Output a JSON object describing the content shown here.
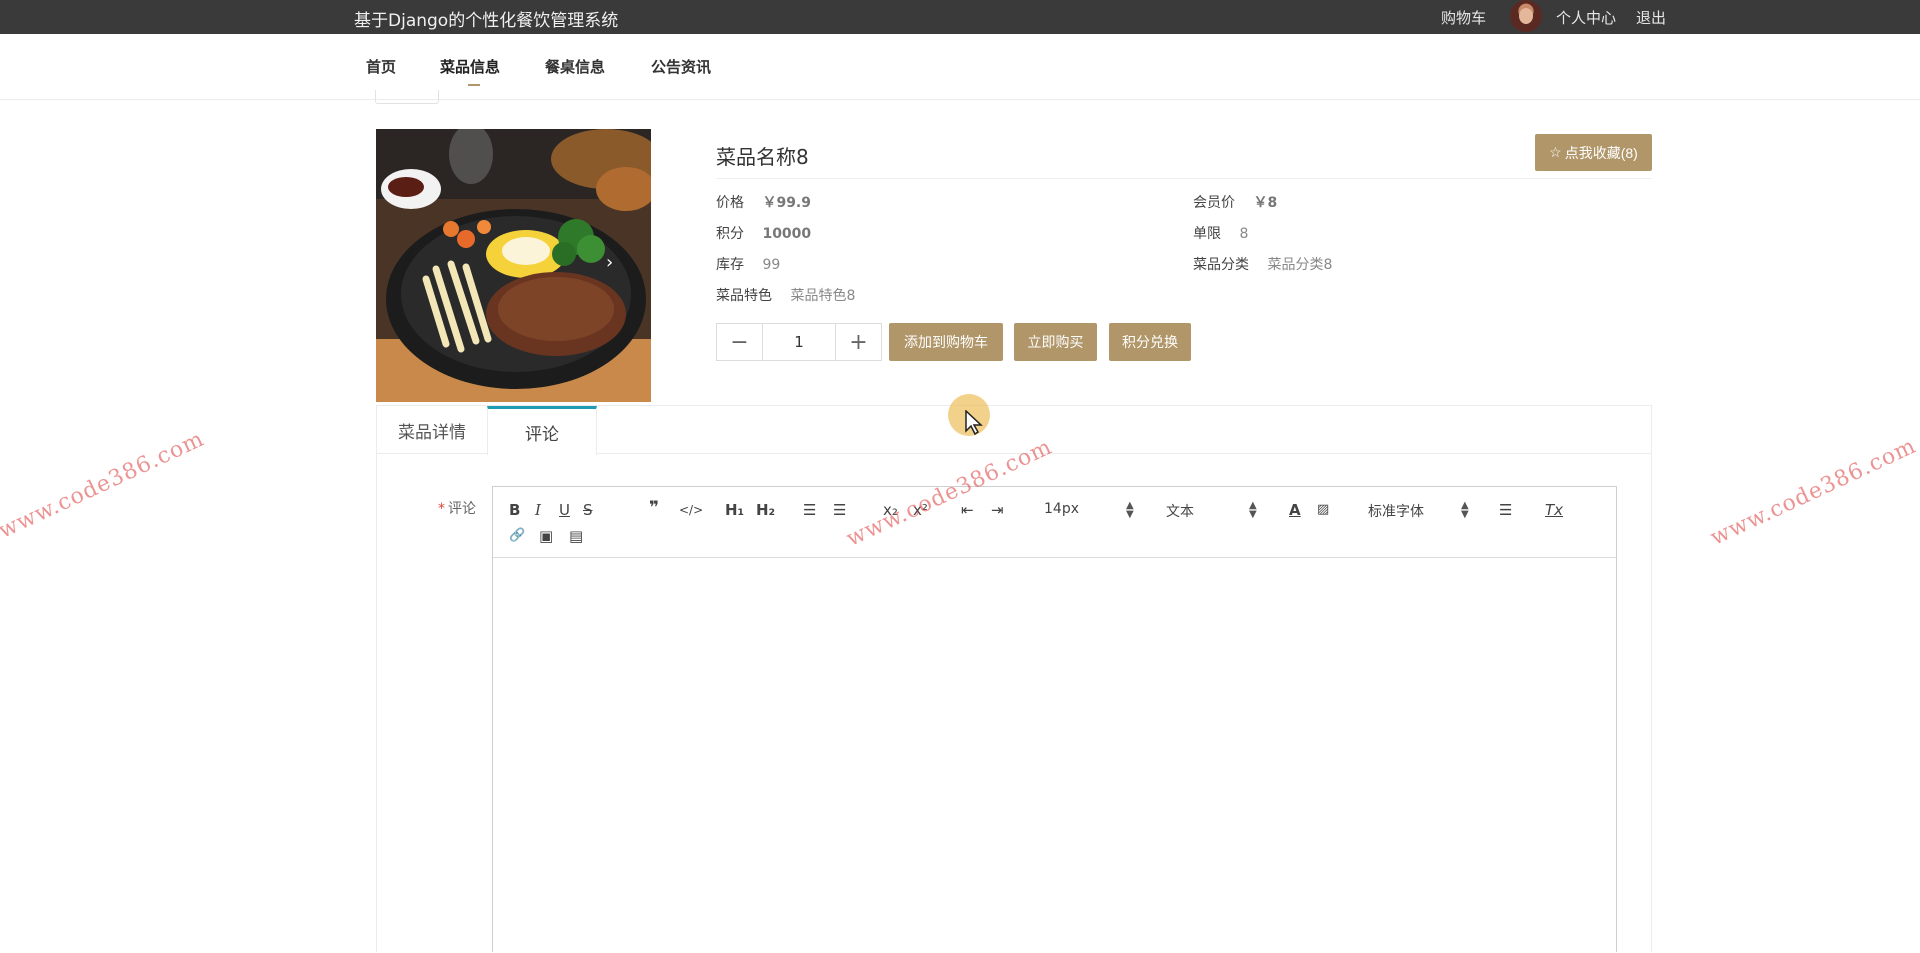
{
  "topbar": {
    "site_title": "基于Django的个性化餐饮管理系统",
    "cart": "购物车",
    "profile": "个人中心",
    "logout": "退出"
  },
  "nav": {
    "items": [
      {
        "label": "首页"
      },
      {
        "label": "菜品信息"
      },
      {
        "label": "餐桌信息"
      },
      {
        "label": "公告资讯"
      }
    ],
    "active_index": 1
  },
  "product": {
    "name": "菜品名称8",
    "favorite_label": "点我收藏(8)",
    "price_label": "价格",
    "price_value": "￥99.9",
    "member_price_label": "会员价",
    "member_price_value": "￥8",
    "points_label": "积分",
    "points_value": "10000",
    "limit_label": "单限",
    "limit_value": "8",
    "stock_label": "库存",
    "stock_value": "99",
    "category_label": "菜品分类",
    "category_value": "菜品分类8",
    "feature_label": "菜品特色",
    "feature_value": "菜品特色8",
    "quantity": "1",
    "minus": "−",
    "plus": "+",
    "add_cart_label": "添加到购物车",
    "buy_now_label": "立即购买",
    "points_exchange_label": "积分兑换"
  },
  "tabs": [
    {
      "label": "菜品详情"
    },
    {
      "label": "评论"
    }
  ],
  "active_tab": 1,
  "comment_form": {
    "required_mark": "*",
    "label": "评论"
  },
  "editor_toolbar": {
    "bold": "B",
    "italic": "I",
    "underline": "U",
    "strike": "S",
    "quote": "❞",
    "code": "</>",
    "h1": "H₁",
    "h2": "H₂",
    "ordered_list": "☰",
    "bullet_list": "☰",
    "subscript": "x₂",
    "superscript": "x²",
    "outdent": "⇤",
    "indent": "⇥",
    "size_value": "14px",
    "header_value": "文本",
    "font_value": "标准字体",
    "align": "☰",
    "clean": "Tx",
    "link": "🔗",
    "image": "▣",
    "video": "▤"
  },
  "watermark": "www.code386.com",
  "colors": {
    "accent": "#b09668",
    "tab_active": "#1e9bb5",
    "topbar_bg": "#3a3a3a"
  }
}
